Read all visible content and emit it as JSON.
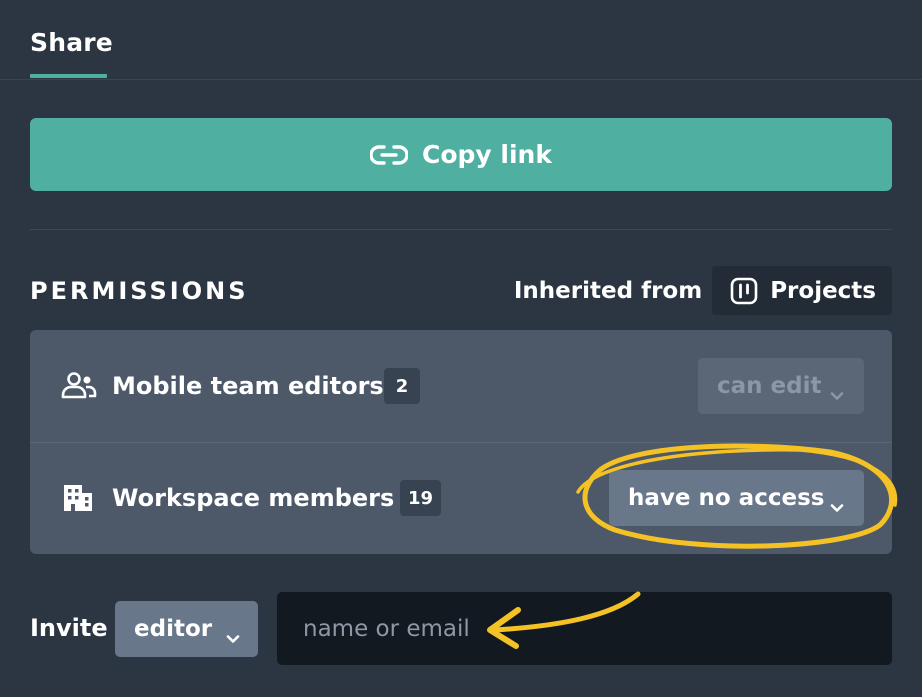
{
  "tabs": {
    "share_label": "Share"
  },
  "copy_link": {
    "label": "Copy link",
    "icon": "link-icon"
  },
  "permissions": {
    "title": "PERMISSIONS",
    "inherited_text": "Inherited from",
    "inherited_source": "Projects",
    "rows": [
      {
        "icon": "people-icon",
        "label": "Mobile team editors",
        "count": "2",
        "access": "can edit",
        "enabled": false
      },
      {
        "icon": "building-icon",
        "label": "Workspace members",
        "count": "19",
        "access": "have no access",
        "enabled": true
      }
    ]
  },
  "invite": {
    "label": "Invite",
    "role": "editor",
    "input_value": "",
    "placeholder": "name or email"
  },
  "colors": {
    "background": "#2c3643",
    "accent": "#4fb0a2",
    "panel": "#4d5969",
    "annotation": "#f5c226"
  }
}
